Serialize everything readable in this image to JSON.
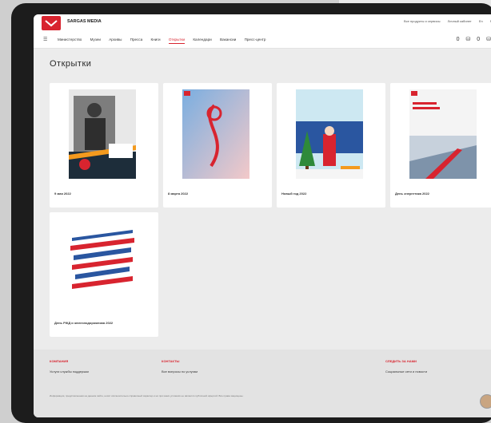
{
  "header": {
    "brand": "SARGAS MEDIA",
    "links": [
      "Все продукты и сервисы",
      "Личный кабинет",
      "En",
      "Ru"
    ]
  },
  "nav": {
    "items": [
      "Министерство",
      "Музеи",
      "Архивы",
      "Пресса",
      "Книги",
      "Открытки",
      "Календари",
      "Вакансии",
      "Пресс-центр"
    ],
    "active_index": 5,
    "icons": [
      "cart-icon",
      "cart-icon"
    ],
    "cart_counts": [
      "0",
      "0"
    ]
  },
  "page": {
    "title": "Открытки"
  },
  "cards": [
    {
      "caption": "9 мая 2022"
    },
    {
      "caption": "8 марта 2022"
    },
    {
      "caption": "Новый год 2022"
    },
    {
      "caption": "День энергетика 2022"
    },
    {
      "caption": "День РЖД и железнодорожника 2022"
    }
  ],
  "footer": {
    "columns": [
      {
        "head": "КОМПАНИЯ",
        "text": "Услуги службы поддержки"
      },
      {
        "head": "КОНТАКТЫ",
        "text": "Все вопросы по услугам"
      },
      {
        "head": "СЛЕДИТЬ ЗА НАМИ",
        "text": "Социальные сети и новости"
      }
    ],
    "fine_print": "Информация, представленная на данном сайте, носит исключительно справочный характер и ни при каких условиях не является публичной офертой. Все права защищены."
  }
}
